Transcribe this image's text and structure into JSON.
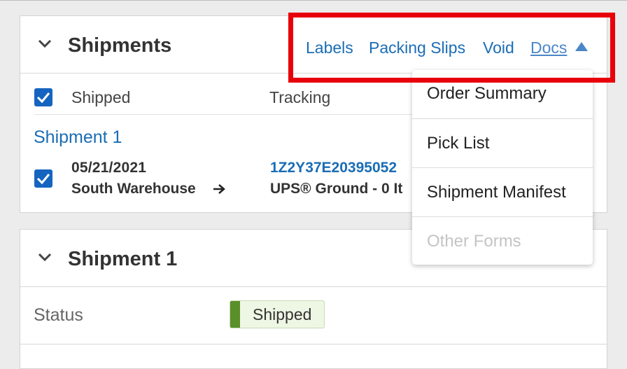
{
  "shipments_card": {
    "title": "Shipments",
    "actions": {
      "labels": "Labels",
      "packing_slips": "Packing Slips",
      "void": "Void",
      "docs": "Docs"
    },
    "columns": {
      "shipped": "Shipped",
      "tracking": "Tracking"
    },
    "shipment": {
      "name": "Shipment 1",
      "date": "05/21/2021",
      "warehouse": "South Warehouse",
      "tracking_number": "1Z2Y37E20395052",
      "carrier": "UPS® Ground - 0 It"
    }
  },
  "docs_menu": {
    "items": [
      "Order Summary",
      "Pick List",
      "Shipment Manifest",
      "Other Forms"
    ]
  },
  "shipment_detail_card": {
    "title": "Shipment 1",
    "status_label": "Status",
    "status_value": "Shipped"
  },
  "colors": {
    "link": "#1a6db5",
    "checkbox": "#1565c0",
    "status_bar": "#5a8f2a",
    "highlight": "#e8000b"
  }
}
